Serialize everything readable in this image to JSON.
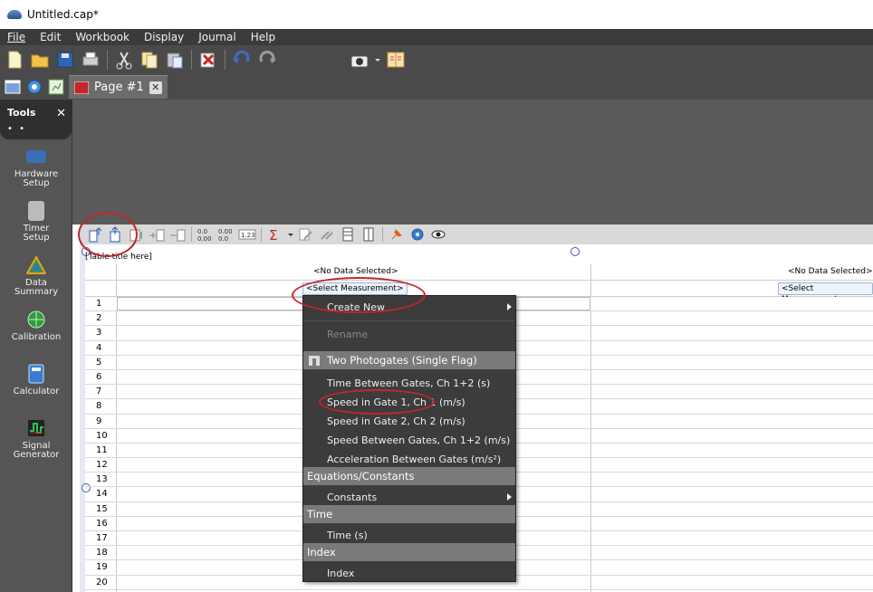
{
  "window": {
    "title": "Untitled.cap*"
  },
  "menu": [
    "File",
    "Edit",
    "Workbook",
    "Display",
    "Journal",
    "Help"
  ],
  "tab": {
    "label": "Page #1",
    "close": "✕"
  },
  "tools": {
    "title": "Tools",
    "close": "✕",
    "items": [
      {
        "label_line1": "Hardware",
        "label_line2": "Setup",
        "icon": "hardware-setup-icon",
        "color": "#3a6fb5"
      },
      {
        "label_line1": "Timer",
        "label_line2": "Setup",
        "icon": "timer-setup-icon",
        "color": "#bbbbbb"
      },
      {
        "label_line1": "Data",
        "label_line2": "Summary",
        "icon": "data-summary-icon",
        "color": "#e8a020"
      },
      {
        "label_line1": "Calibration",
        "label_line2": "",
        "icon": "calibration-icon",
        "color": "#2e9e3c"
      },
      {
        "label_line1": "Calculator",
        "label_line2": "",
        "icon": "calculator-icon",
        "color": "#3a7cd0"
      },
      {
        "label_line1": "Signal",
        "label_line2": "Generator",
        "icon": "signal-generator-icon",
        "color": "#2e9e3c"
      }
    ]
  },
  "table": {
    "title": "[Table title here]",
    "col1": {
      "header": "<No Data Selected>",
      "select": "<Select Measurement>"
    },
    "col2": {
      "header": "<No Data Selected>",
      "select": "<Select Measurement>"
    },
    "rows": [
      "1",
      "2",
      "3",
      "4",
      "5",
      "6",
      "7",
      "8",
      "9",
      "10",
      "11",
      "12",
      "13",
      "14",
      "15",
      "16",
      "17",
      "18",
      "19",
      "20"
    ]
  },
  "context_menu": {
    "create_new": "Create New",
    "rename": "Rename",
    "group1": "Two Photogates (Single Flag)",
    "items1": [
      "Time Between Gates, Ch 1+2 (s)",
      "Speed in Gate 1, Ch 1 (m/s)",
      "Speed in Gate 2, Ch 2 (m/s)",
      "Speed Between Gates, Ch 1+2 (m/s)",
      "Acceleration Between Gates (m/s²)"
    ],
    "group2": "Equations/Constants",
    "constants": "Constants",
    "group3": "Time",
    "time": "Time (s)",
    "group4": "Index",
    "index": "Index"
  }
}
